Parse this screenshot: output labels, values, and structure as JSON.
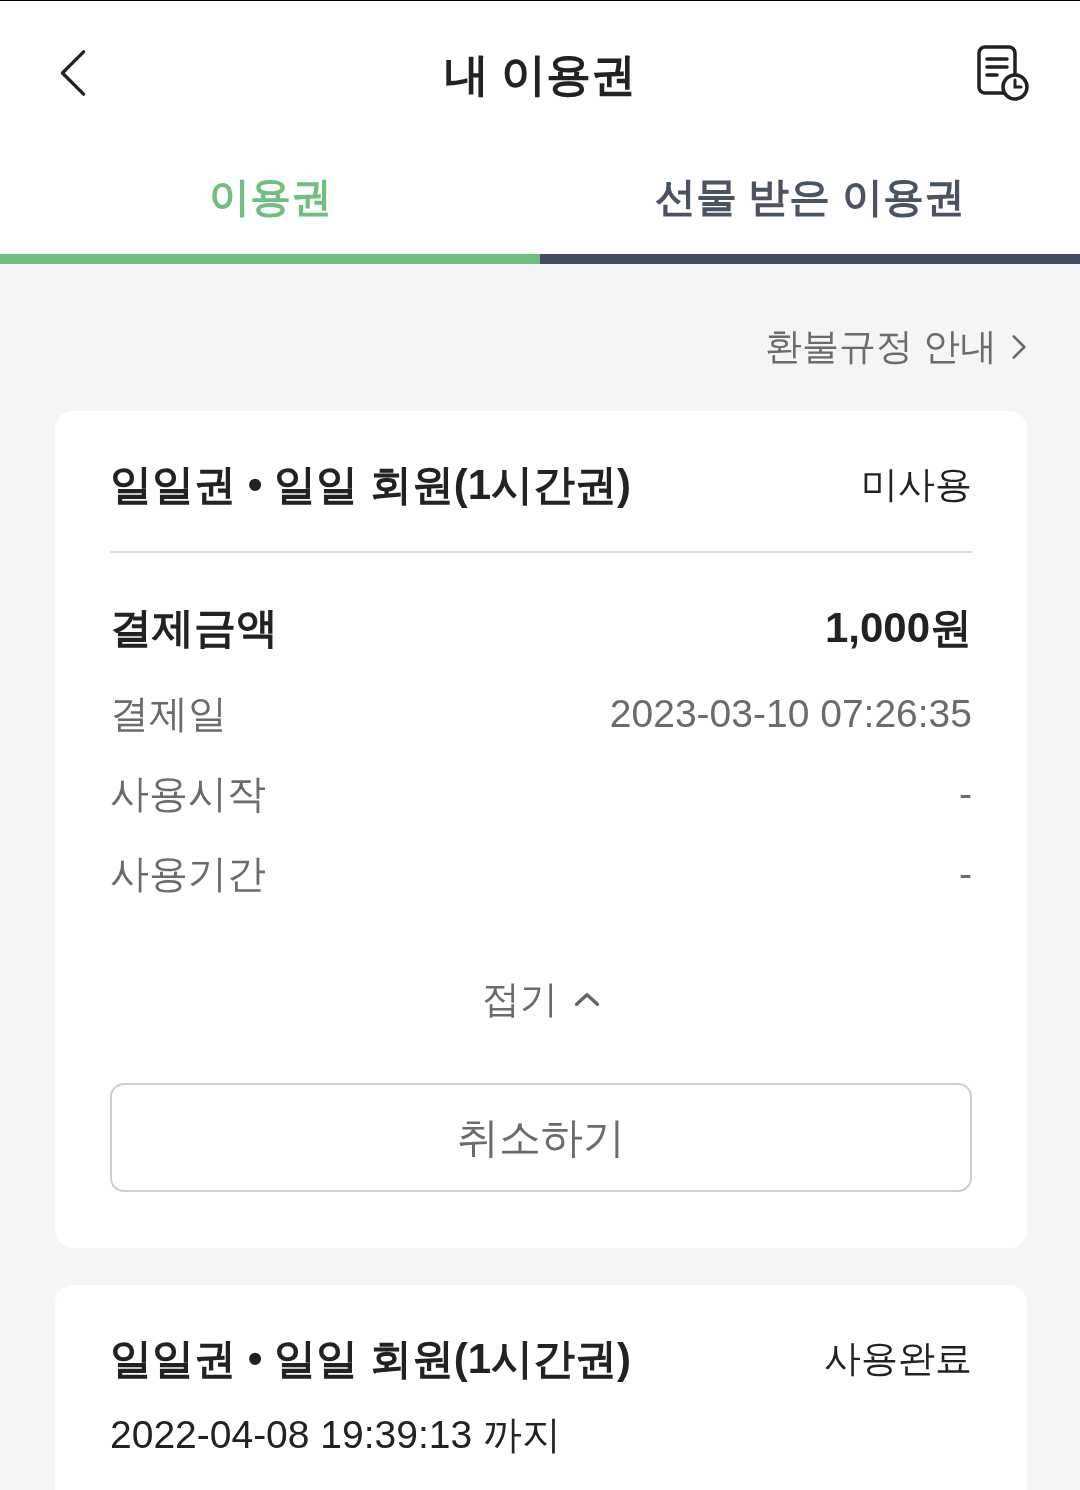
{
  "header": {
    "title": "내 이용권"
  },
  "tabs": [
    {
      "label": "이용권",
      "selected": true
    },
    {
      "label": "선물 받은 이용권",
      "selected": false
    }
  ],
  "refund_link": {
    "label": "환불규정 안내"
  },
  "tickets": [
    {
      "title": "일일권 • 일일 회원(1시간권)",
      "status": "미사용",
      "expanded": true,
      "details": [
        {
          "kind": "total",
          "label": "결제금액",
          "value": "1,000원"
        },
        {
          "kind": "info",
          "label": "결제일",
          "value": "2023-03-10 07:26:35"
        },
        {
          "kind": "info",
          "label": "사용시작",
          "value": "-"
        },
        {
          "kind": "info",
          "label": "사용기간",
          "value": "-"
        }
      ],
      "toggle": "접기",
      "button": "취소하기"
    },
    {
      "title": "일일권 • 일일 회원(1시간권)",
      "status": "사용완료",
      "expanded": false,
      "expiry": "2022-04-08 19:39:13 까지"
    }
  ]
}
